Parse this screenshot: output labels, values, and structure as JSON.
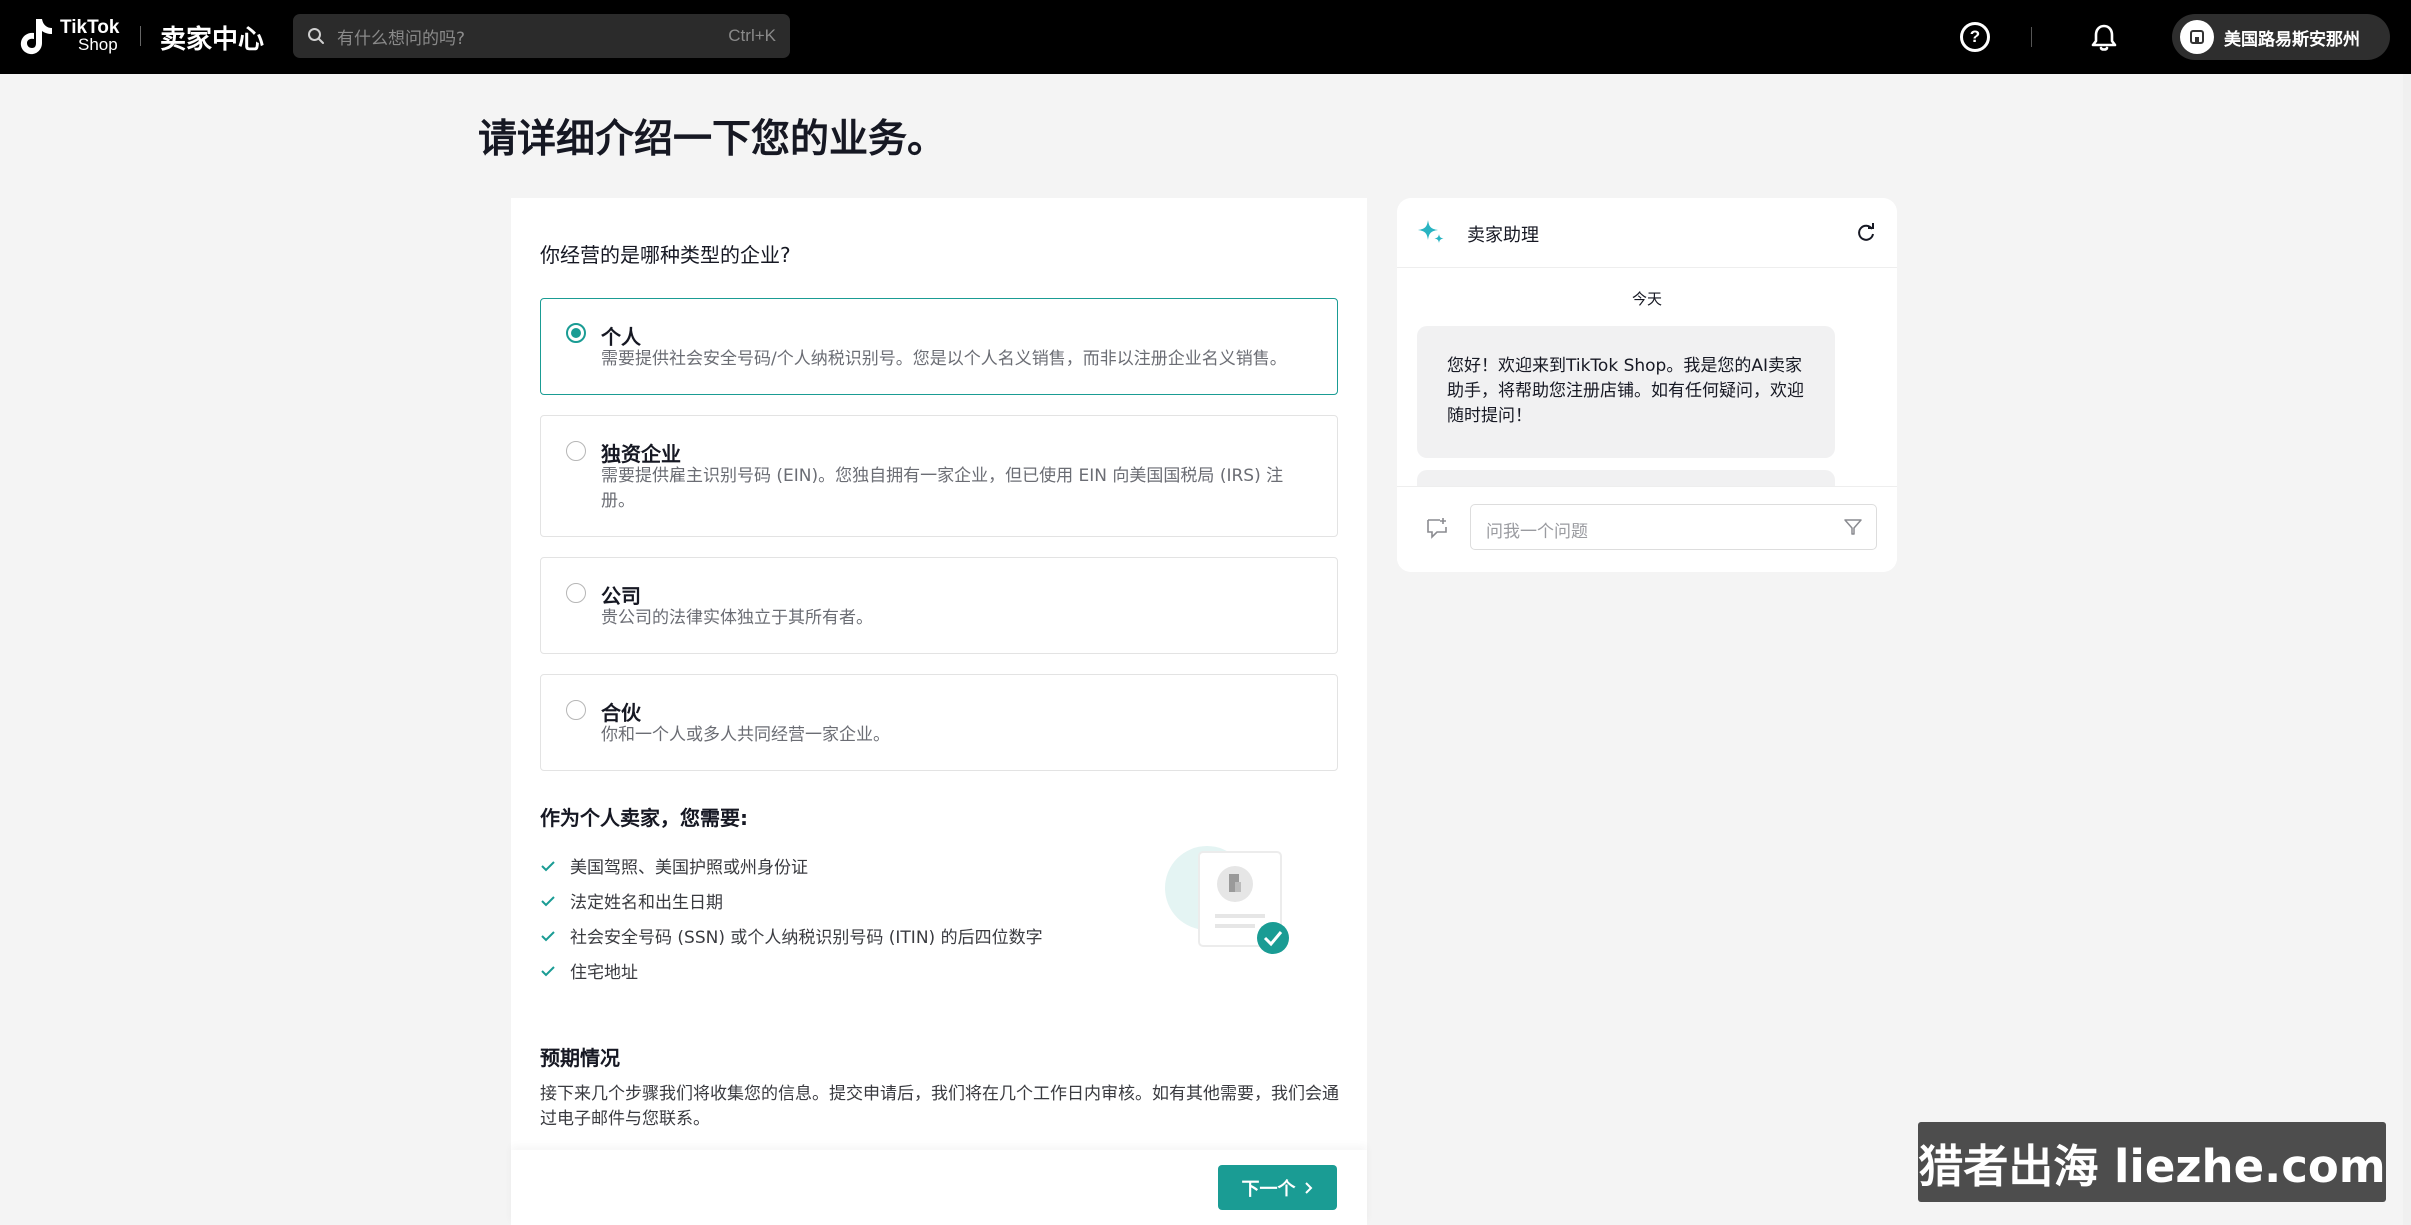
{
  "header": {
    "logo_line1": "TikTok",
    "logo_line2": "Shop",
    "app_title": "卖家中心",
    "search_placeholder": "有什么想问的吗?",
    "search_shortcut": "Ctrl+K",
    "store_name": "美国路易斯安那州"
  },
  "page": {
    "title": "请详细介绍一下您的业务。"
  },
  "form": {
    "question": "你经营的是哪种类型的企业?",
    "options": [
      {
        "title": "个人",
        "desc": "需要提供社会安全号码/个人纳税识别号。您是以个人名义销售，而非以注册企业名义销售。",
        "selected": true
      },
      {
        "title": "独资企业",
        "desc": "需要提供雇主识别号码 (EIN)。您独自拥有一家企业，但已使用 EIN 向美国国税局 (IRS) 注册。",
        "selected": false
      },
      {
        "title": "公司",
        "desc": "贵公司的法律实体独立于其所有者。",
        "selected": false
      },
      {
        "title": "合伙",
        "desc": "你和一个人或多人共同经营一家企业。",
        "selected": false
      }
    ],
    "requirements_title": "作为个人卖家，您需要:",
    "requirements": [
      "美国驾照、美国护照或州身份证",
      "法定姓名和出生日期",
      "社会安全号码 (SSN) 或个人纳税识别号码 (ITIN) 的后四位数字",
      "住宅地址"
    ],
    "expect_title": "预期情况",
    "expect_desc": "接下来几个步骤我们将收集您的信息。提交申请后，我们将在几个工作日内审核。如有其他需要，我们会通过电子邮件与您联系。",
    "next_label": "下一个"
  },
  "assistant": {
    "title": "卖家助理",
    "date_label": "今天",
    "message": "您好！欢迎来到TikTok Shop。我是您的AI卖家助手，将帮助您注册店铺。如有任何疑问，欢迎随时提问！",
    "input_placeholder": "问我一个问题"
  },
  "watermark": "猎者出海 liezhe.com",
  "colors": {
    "accent": "#1a9c94",
    "topbar": "#000000",
    "background": "#f4f4f4"
  }
}
